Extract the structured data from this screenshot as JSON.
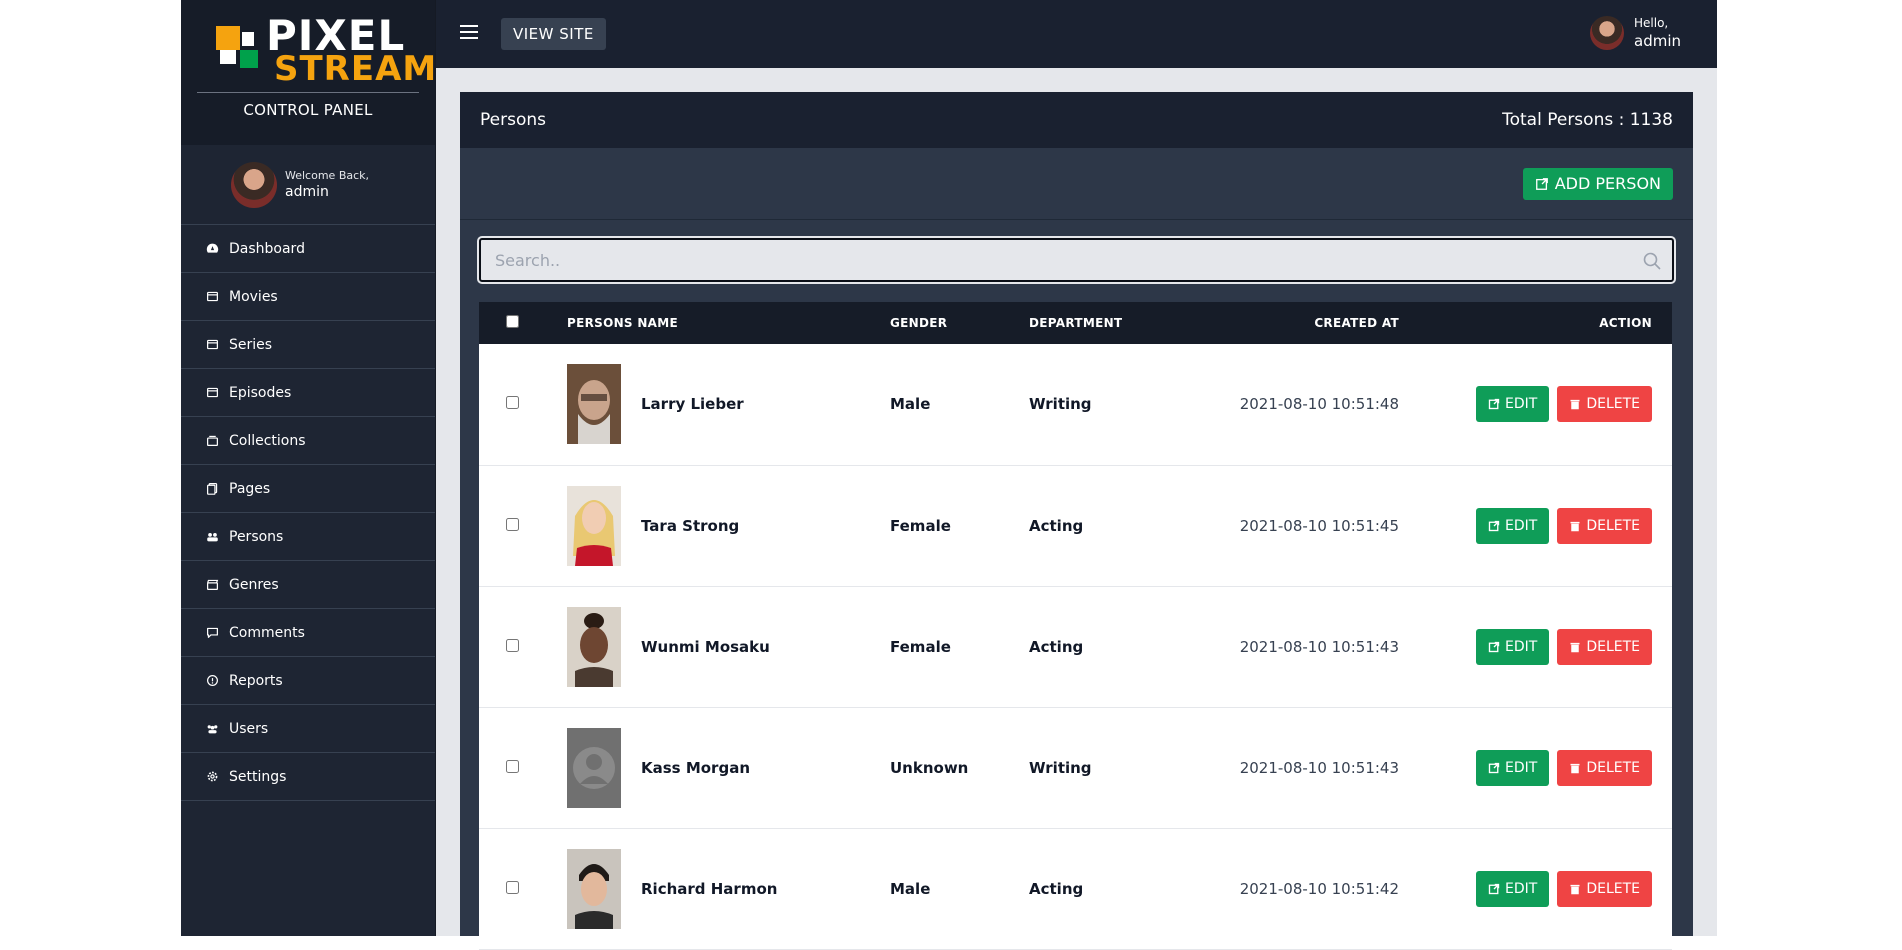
{
  "sidebar": {
    "logo_word1": "PIXEL",
    "logo_word2": "STREAM",
    "subtitle": "CONTROL PANEL",
    "profile": {
      "welcome": "Welcome Back,",
      "name": "admin"
    },
    "items": [
      {
        "label": "Dashboard",
        "icon": "dashboard-icon"
      },
      {
        "label": "Movies",
        "icon": "film-icon"
      },
      {
        "label": "Series",
        "icon": "film-icon"
      },
      {
        "label": "Episodes",
        "icon": "film-icon"
      },
      {
        "label": "Collections",
        "icon": "collection-icon"
      },
      {
        "label": "Pages",
        "icon": "pages-icon"
      },
      {
        "label": "Persons",
        "icon": "people-icon"
      },
      {
        "label": "Genres",
        "icon": "clapper-icon"
      },
      {
        "label": "Comments",
        "icon": "comment-icon"
      },
      {
        "label": "Reports",
        "icon": "alert-icon"
      },
      {
        "label": "Users",
        "icon": "users-icon"
      },
      {
        "label": "Settings",
        "icon": "gear-icon"
      }
    ]
  },
  "topbar": {
    "view_site": "VIEW SITE",
    "hello": "Hello,",
    "user": "admin"
  },
  "panel": {
    "title": "Persons",
    "total": "Total Persons : 1138",
    "add_button": "ADD PERSON"
  },
  "search": {
    "placeholder": "Search.."
  },
  "table": {
    "headers": {
      "name": "PERSONS NAME",
      "gender": "GENDER",
      "department": "DEPARTMENT",
      "created": "CREATED AT",
      "action": "ACTION"
    },
    "edit_label": "EDIT",
    "delete_label": "DELETE",
    "rows": [
      {
        "name": "Larry Lieber",
        "gender": "Male",
        "department": "Writing",
        "created": "2021-08-10 10:51:48",
        "photo": "photo-older-man"
      },
      {
        "name": "Tara Strong",
        "gender": "Female",
        "department": "Acting",
        "created": "2021-08-10 10:51:45",
        "photo": "photo-blonde-woman"
      },
      {
        "name": "Wunmi Mosaku",
        "gender": "Female",
        "department": "Acting",
        "created": "2021-08-10 10:51:43",
        "photo": "photo-woman"
      },
      {
        "name": "Kass Morgan",
        "gender": "Unknown",
        "department": "Writing",
        "created": "2021-08-10 10:51:43",
        "photo": "photo-placeholder"
      },
      {
        "name": "Richard Harmon",
        "gender": "Male",
        "department": "Acting",
        "created": "2021-08-10 10:51:42",
        "photo": "photo-young-man"
      }
    ]
  },
  "colors": {
    "sidebar": "#1e2533",
    "topbar": "#1a2130",
    "panel": "#2d3748",
    "accent_green": "#0f9d58",
    "danger_red": "#ef4444",
    "logo_orange": "#f5a30f"
  }
}
